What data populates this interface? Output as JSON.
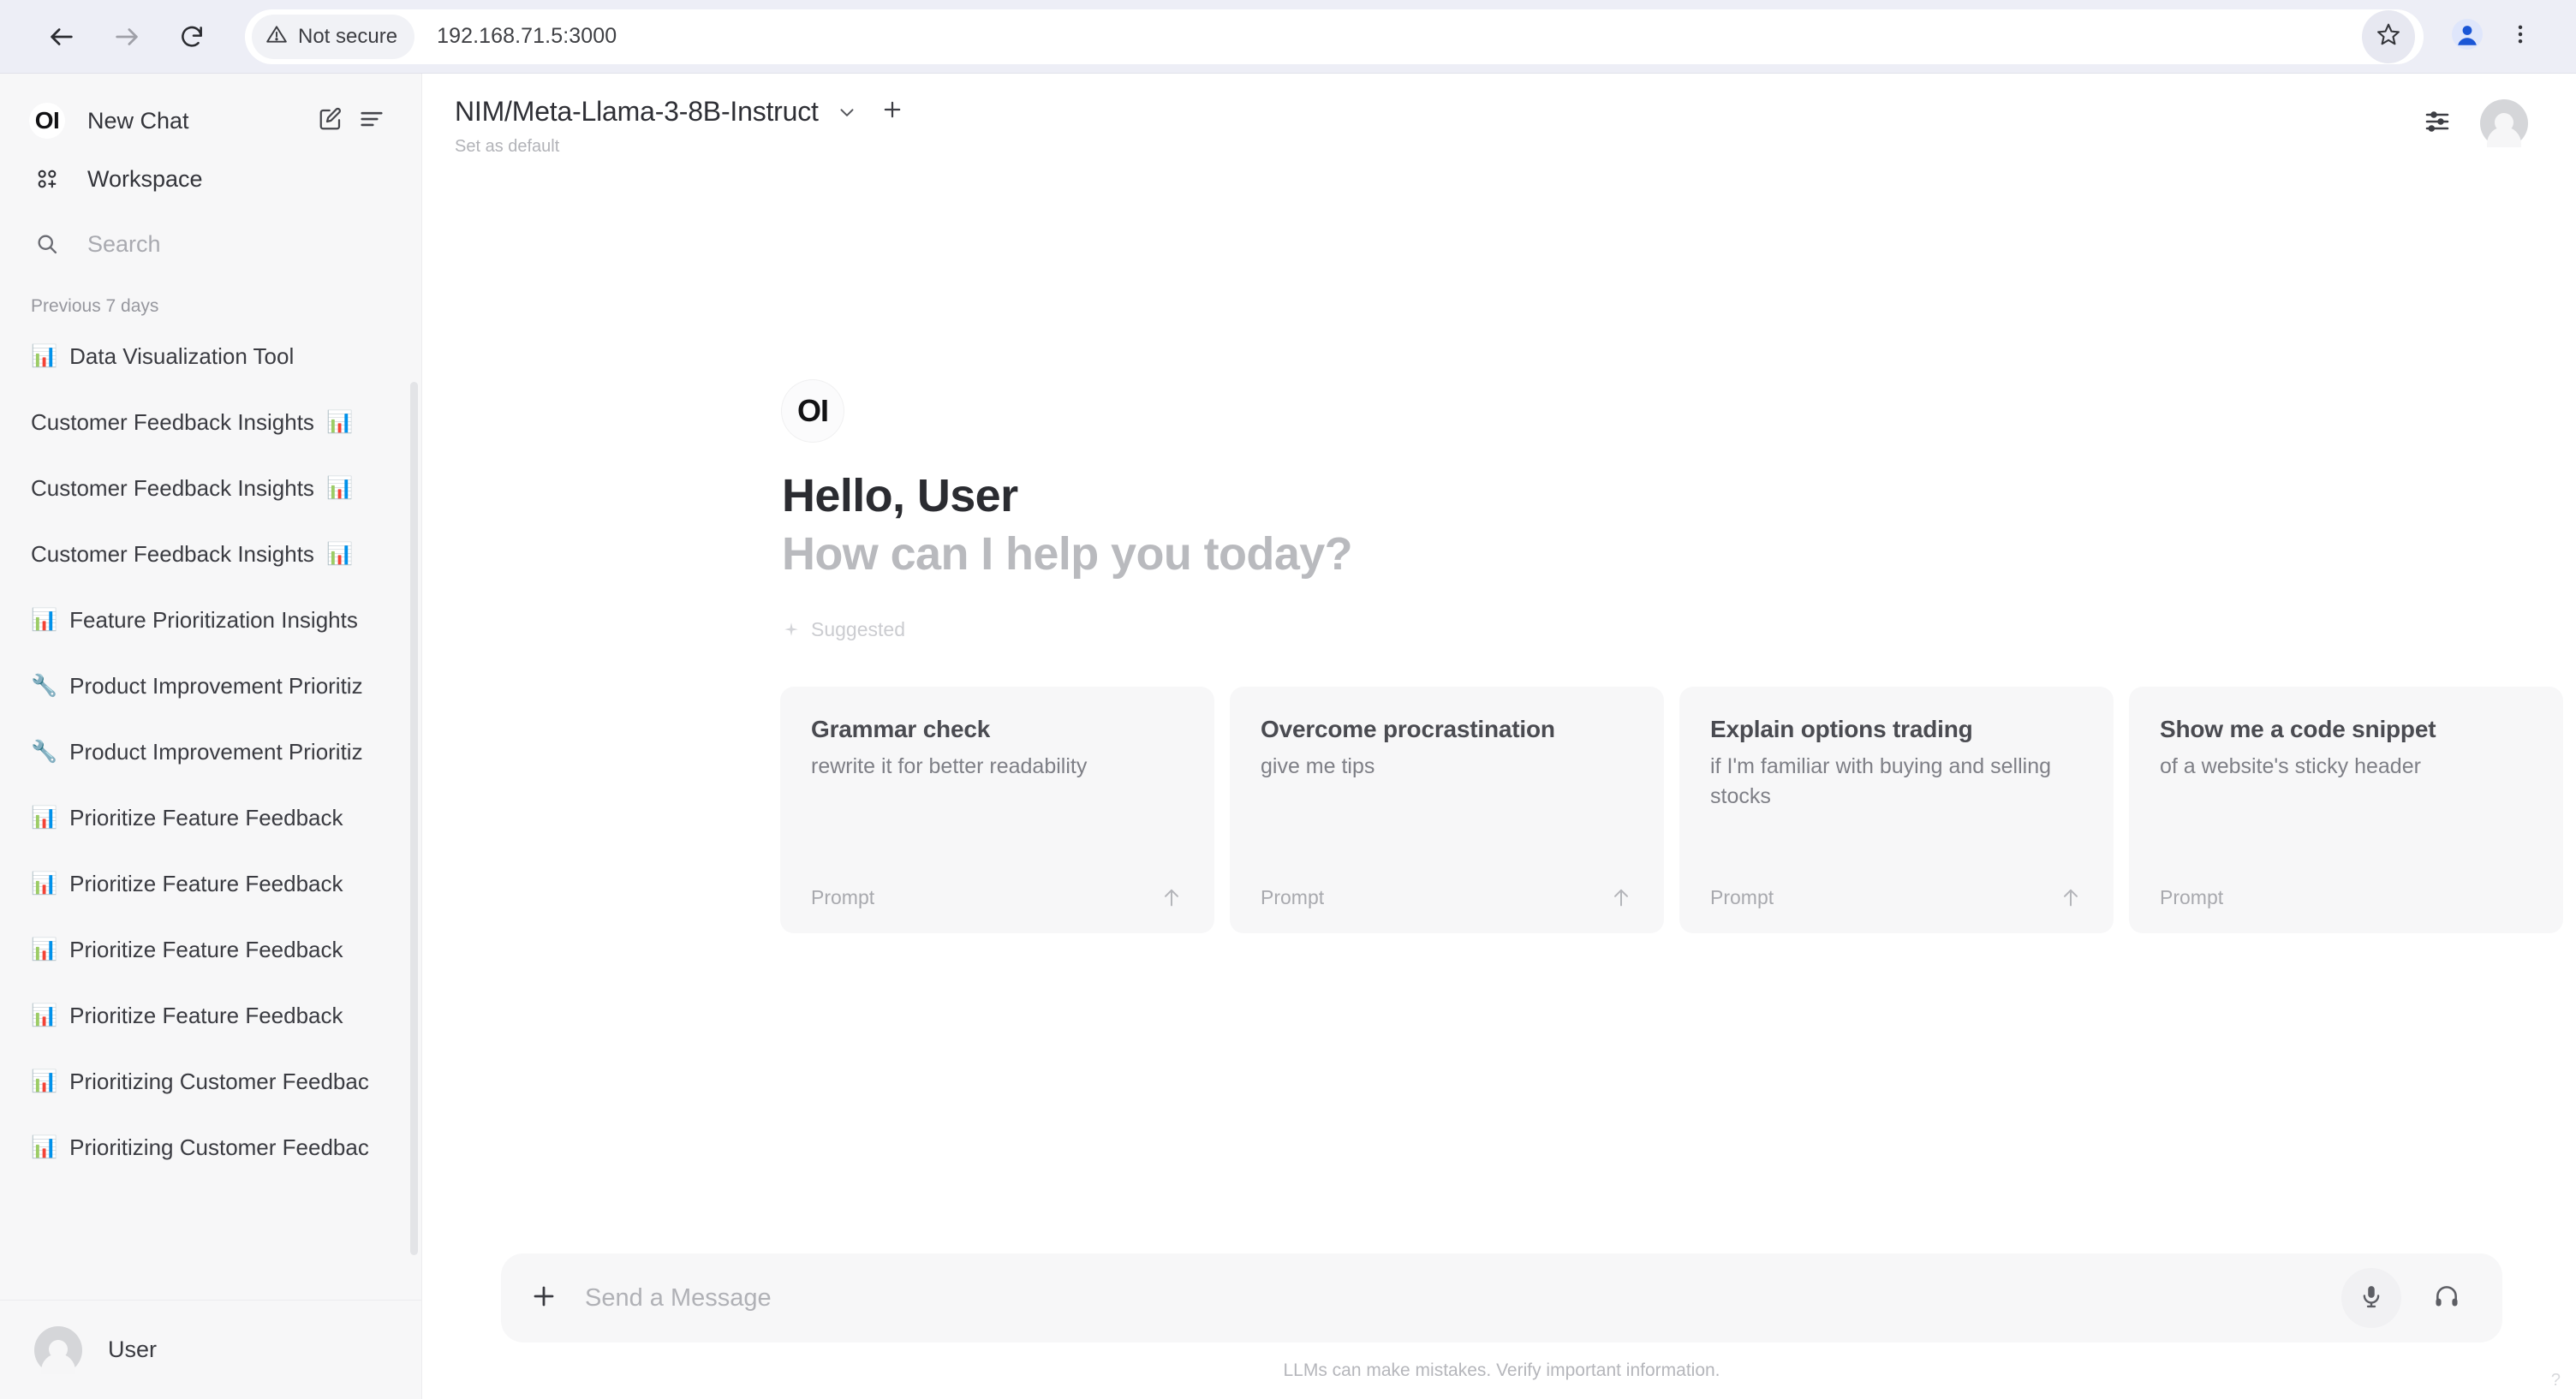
{
  "browser": {
    "back_icon": "back-arrow-icon",
    "forward_icon": "forward-arrow-icon",
    "reload_icon": "reload-icon",
    "security_label": "Not secure",
    "security_icon": "warning-triangle-icon",
    "url": "192.168.71.5:3000",
    "bookmark_icon": "star-icon",
    "profile_icon": "profile-icon",
    "menu_icon": "three-dot-menu-icon"
  },
  "sidebar": {
    "logo_text": "OI",
    "new_chat_label": "New Chat",
    "new_chat_icon": "pencil-square-icon",
    "sort_icon": "sort-lines-icon",
    "workspace_label": "Workspace",
    "workspace_icon": "workspace-grid-icon",
    "search_icon": "search-icon",
    "search_placeholder": "Search",
    "search_value": "",
    "section_label": "Previous 7 days",
    "chats": [
      {
        "emoji": "📊",
        "title": "Data Visualization Tool",
        "emoji_position": "lead"
      },
      {
        "emoji": "📊",
        "title": "Customer Feedback Insights",
        "emoji_position": "trail"
      },
      {
        "emoji": "📊",
        "title": "Customer Feedback Insights",
        "emoji_position": "trail"
      },
      {
        "emoji": "📊",
        "title": "Customer Feedback Insights",
        "emoji_position": "trail"
      },
      {
        "emoji": "📊",
        "title": "Feature Prioritization Insights",
        "emoji_position": "lead"
      },
      {
        "emoji": "🔧",
        "title": "Product Improvement Prioritiz",
        "emoji_position": "lead"
      },
      {
        "emoji": "🔧",
        "title": "Product Improvement Prioritiz",
        "emoji_position": "lead"
      },
      {
        "emoji": "📊",
        "title": "Prioritize Feature Feedback",
        "emoji_position": "lead"
      },
      {
        "emoji": "📊",
        "title": "Prioritize Feature Feedback",
        "emoji_position": "lead"
      },
      {
        "emoji": "📊",
        "title": "Prioritize Feature Feedback",
        "emoji_position": "lead"
      },
      {
        "emoji": "📊",
        "title": "Prioritize Feature Feedback",
        "emoji_position": "lead"
      },
      {
        "emoji": "📊",
        "title": "Prioritizing Customer Feedbac",
        "emoji_position": "lead"
      },
      {
        "emoji": "📊",
        "title": "Prioritizing Customer Feedbac",
        "emoji_position": "lead"
      }
    ],
    "footer_username": "User",
    "footer_avatar_icon": "avatar-icon"
  },
  "header": {
    "model_name": "NIM/Meta-Llama-3-8B-Instruct",
    "chevron_icon": "chevron-down-icon",
    "plus_icon": "plus-icon",
    "set_default_label": "Set as default",
    "controls_icon": "sliders-icon",
    "avatar_icon": "avatar-icon"
  },
  "greeting": {
    "logo_text": "OI",
    "hello": "Hello, User",
    "subtitle": "How can I help you today?",
    "suggested_label": "Suggested",
    "sparkle_icon": "sparkle-icon"
  },
  "cards": [
    {
      "title": "Grammar check",
      "subtitle": "rewrite it for better readability",
      "prompt_label": "Prompt",
      "arrow_icon": "arrow-up-icon"
    },
    {
      "title": "Overcome procrastination",
      "subtitle": "give me tips",
      "prompt_label": "Prompt",
      "arrow_icon": "arrow-up-icon"
    },
    {
      "title": "Explain options trading",
      "subtitle": "if I'm familiar with buying and selling stocks",
      "prompt_label": "Prompt",
      "arrow_icon": "arrow-up-icon"
    },
    {
      "title": "Show me a code snippet",
      "subtitle": "of a website's sticky header",
      "prompt_label": "Prompt",
      "arrow_icon": "arrow-up-icon"
    }
  ],
  "composer": {
    "plus_icon": "plus-icon",
    "placeholder": "Send a Message",
    "value": "",
    "mic_icon": "microphone-icon",
    "headphone_icon": "headphone-icon",
    "disclaimer": "LLMs can make mistakes. Verify important information."
  },
  "colors": {
    "browser_bar": "#edeef6",
    "sidebar_bg": "#f7f7f8",
    "card_bg": "#f7f7f8",
    "profile_blue": "#1a56d6"
  }
}
